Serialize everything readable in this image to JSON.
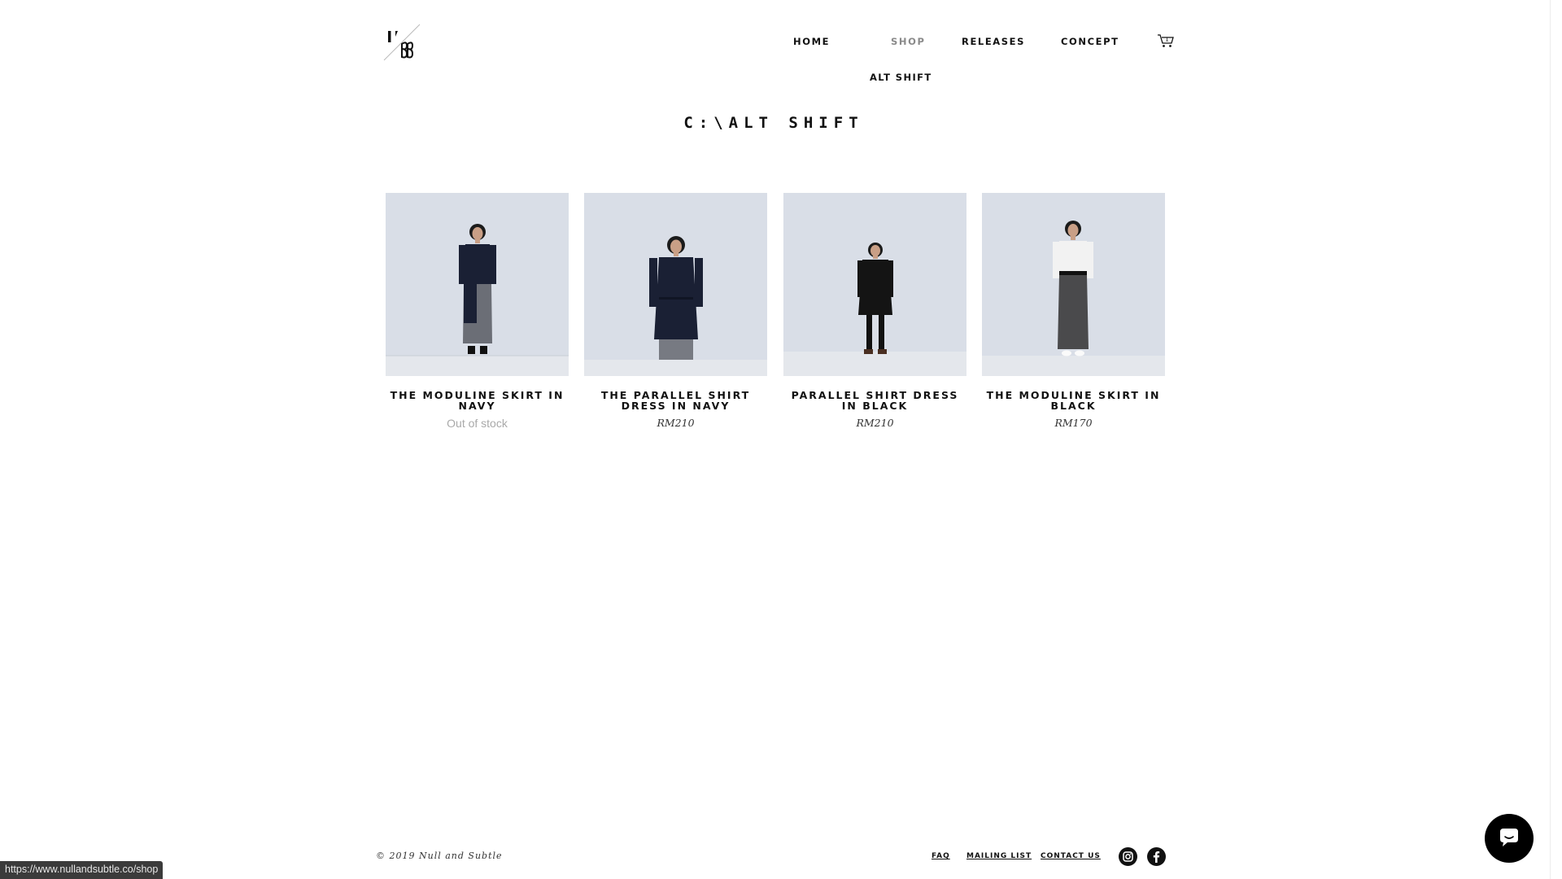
{
  "header": {
    "nav": [
      {
        "label": "HOME",
        "active": false
      },
      {
        "label": "SHOP",
        "active": true
      },
      {
        "label": "RELEASES",
        "active": false
      },
      {
        "label": "CONCEPT",
        "active": false
      }
    ],
    "subnav_label": "ALT SHIFT",
    "cart_count": "1"
  },
  "page_title": "C:\\ALT SHIFT",
  "products": [
    {
      "name": "THE MODULINE SKIRT IN NAVY",
      "price": "",
      "stock": "Out of stock",
      "outfit": "navy-skirt"
    },
    {
      "name": "THE PARALLEL SHIRT DRESS IN NAVY",
      "price": "RM210",
      "stock": "",
      "outfit": "navy-dress"
    },
    {
      "name": "PARALLEL SHIRT DRESS IN BLACK",
      "price": "RM210",
      "stock": "",
      "outfit": "black-dress"
    },
    {
      "name": "THE MODULINE SKIRT IN BLACK",
      "price": "RM170",
      "stock": "",
      "outfit": "black-skirt"
    }
  ],
  "footer": {
    "copyright": "© 2019 Null and Subtle",
    "links": {
      "faq": "FAQ",
      "mailing": "MAILING LIST",
      "contact": "CONTACT US"
    },
    "social": [
      "instagram-icon",
      "facebook-icon"
    ]
  },
  "status_bar_url": "https://www.nullandsubtle.co/shop",
  "colors": {
    "thumb_bg": "#d9dee7",
    "active_nav": "#8a8a8a",
    "stock_gray": "#a9a9a9"
  }
}
